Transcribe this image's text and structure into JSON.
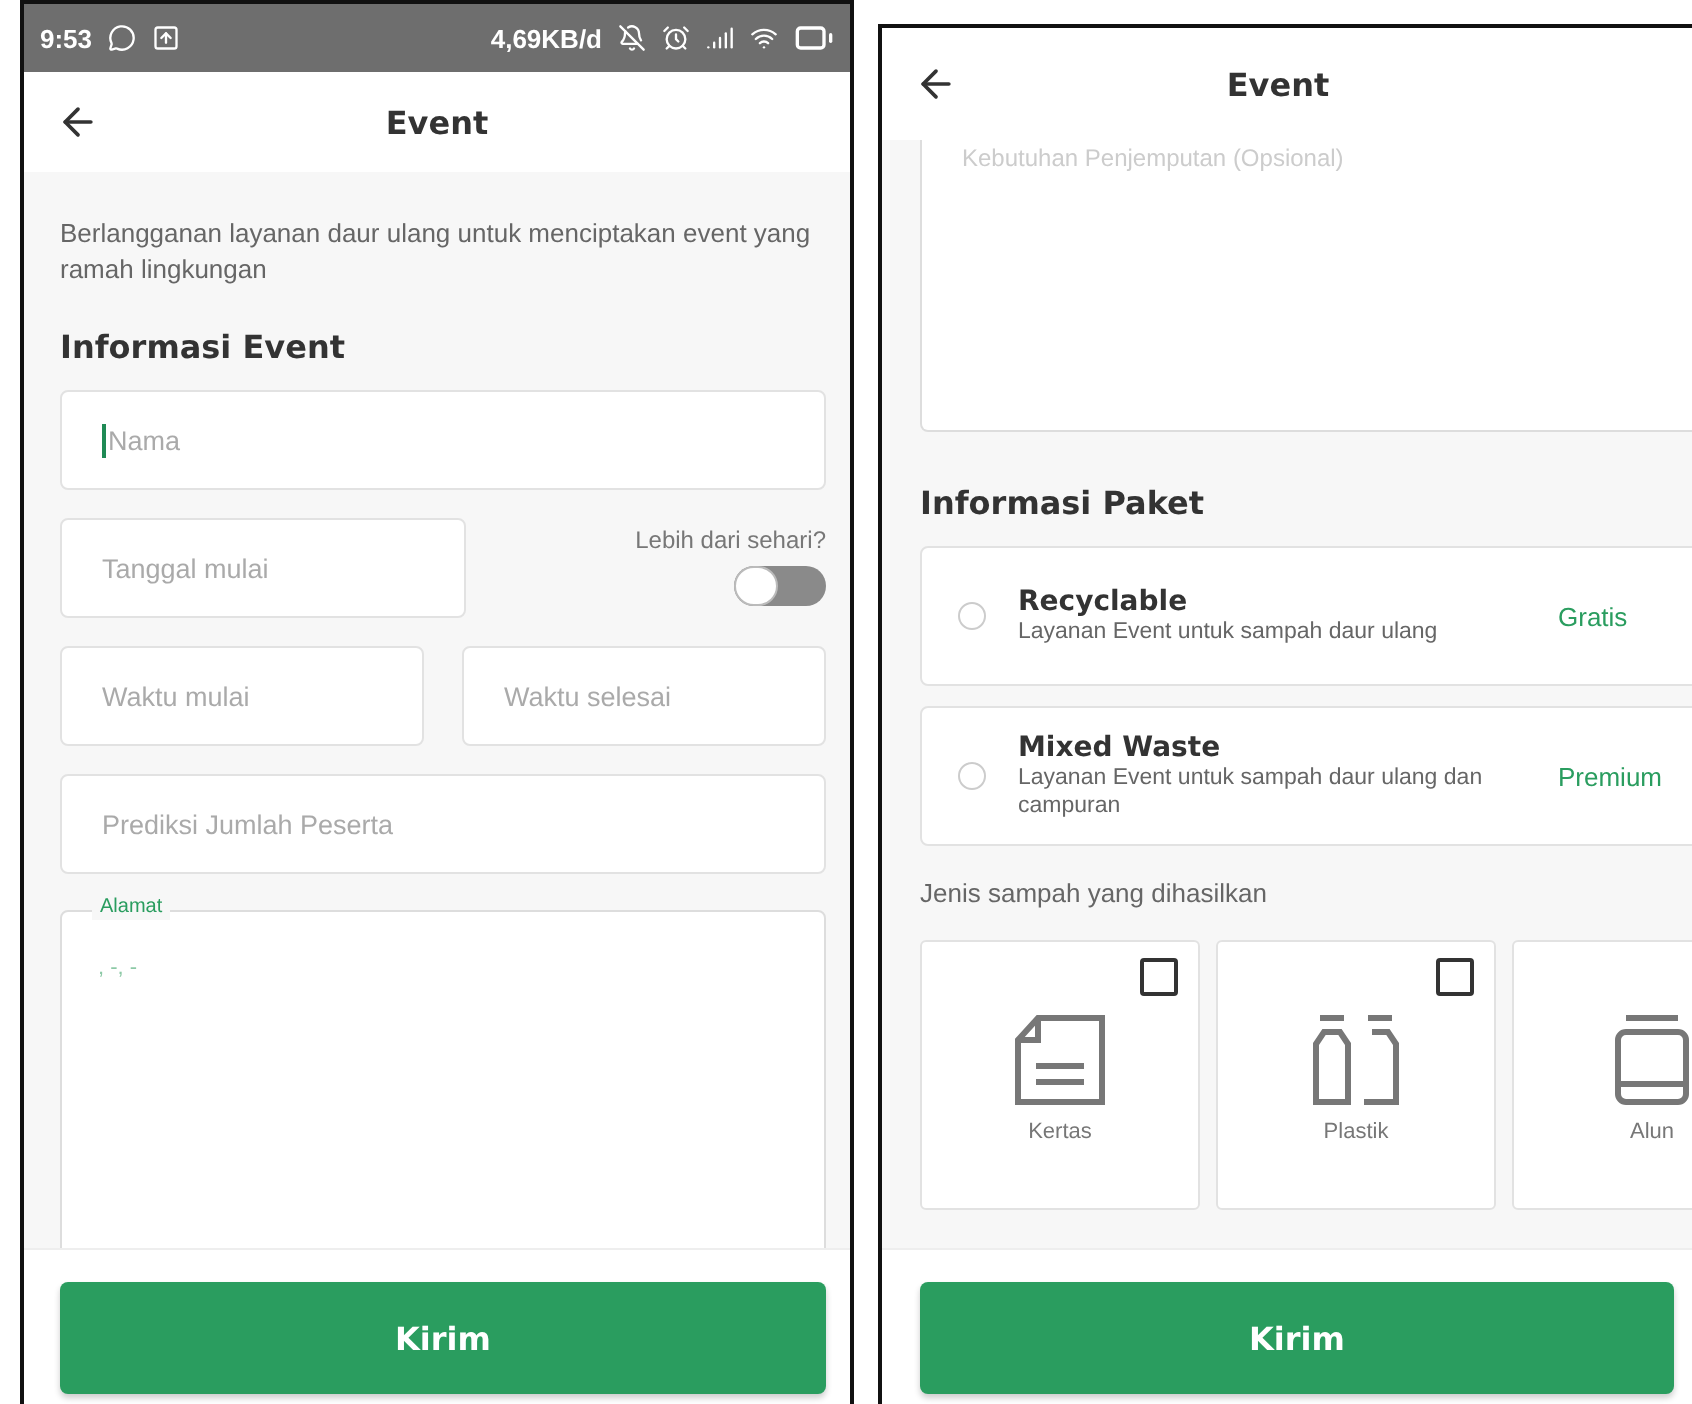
{
  "left_screen": {
    "status_bar": {
      "time": "9:53",
      "network_speed": "4,69KB/d"
    },
    "header": {
      "title": "Event"
    },
    "intro": "Berlangganan layanan daur ulang untuk menciptakan event yang ramah lingkungan",
    "section_title": "Informasi Event",
    "name_field": {
      "placeholder": "Nama"
    },
    "start_date_field": {
      "placeholder": "Tanggal mulai"
    },
    "multi_day_toggle": {
      "label": "Lebih dari sehari?",
      "on": false
    },
    "start_time_field": {
      "placeholder": "Waktu mulai"
    },
    "end_time_field": {
      "placeholder": "Waktu selesai"
    },
    "participants_field": {
      "placeholder": "Prediksi Jumlah Peserta"
    },
    "address_field": {
      "label": "Alamat",
      "value": ", -, -"
    },
    "submit_button": "Kirim"
  },
  "right_screen": {
    "header": {
      "title": "Event"
    },
    "pickup_field": {
      "placeholder": "Kebutuhan Penjemputan (Opsional)"
    },
    "section_title": "Informasi Paket",
    "packages": [
      {
        "name": "Recyclable",
        "description": "Layanan Event untuk sampah daur ulang",
        "price": "Gratis",
        "selected": false
      },
      {
        "name": "Mixed Waste",
        "description": "Layanan Event untuk sampah daur ulang dan campuran",
        "price": "Premium",
        "selected": false
      }
    ],
    "waste_label": "Jenis sampah yang dihasilkan",
    "waste_types": [
      {
        "kind": "paper",
        "label": "Kertas",
        "checked": false
      },
      {
        "kind": "bottles",
        "label": "Plastik",
        "checked": false
      },
      {
        "kind": "can",
        "label": "Alun"
      }
    ],
    "submit_button": "Kirim"
  }
}
